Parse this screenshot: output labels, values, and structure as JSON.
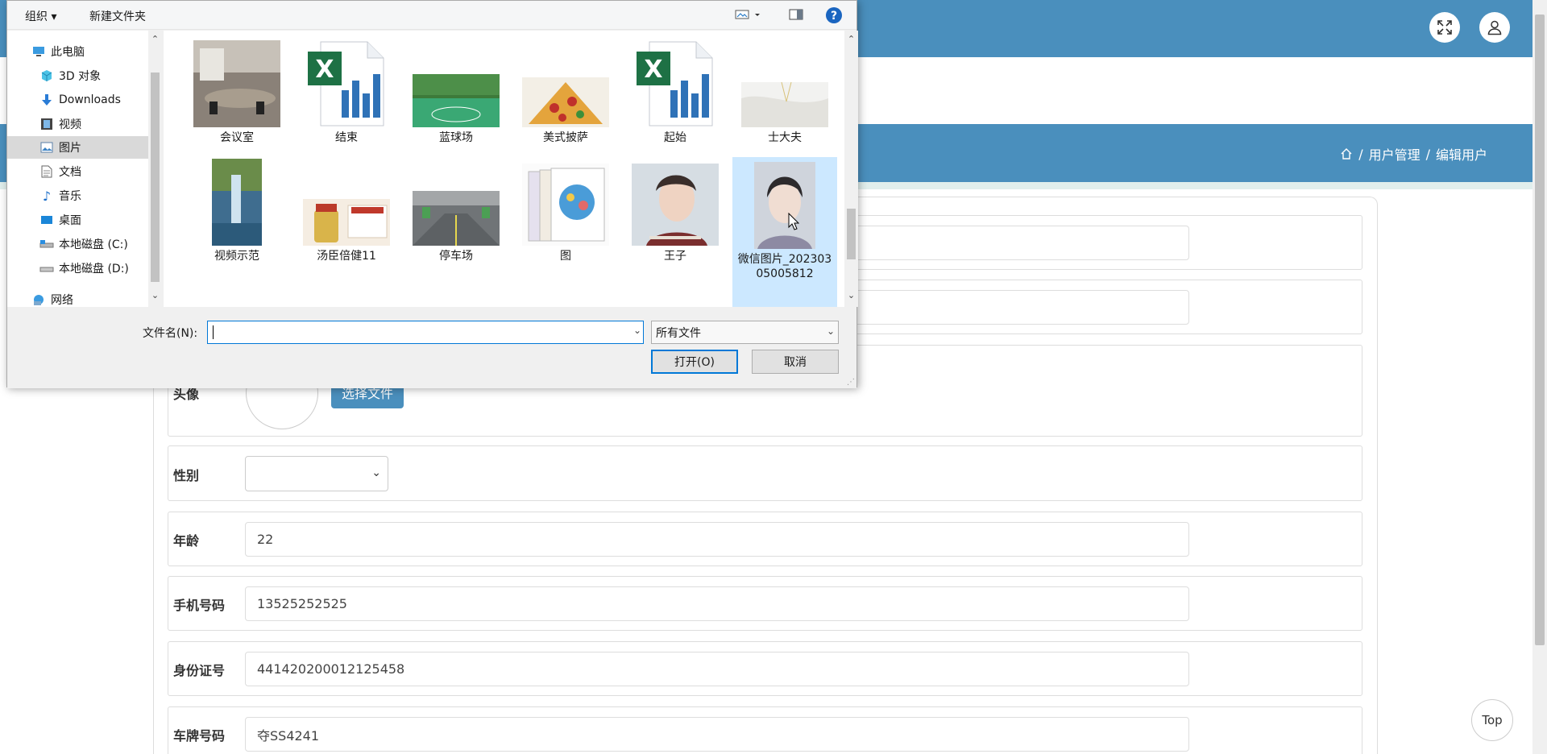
{
  "header": {
    "expand_icon": "expand-arrows-icon",
    "user_icon": "user-icon"
  },
  "breadcrumb": {
    "home_icon": "home-icon",
    "sep": "/",
    "item1": "用户管理",
    "item2": "编辑用户"
  },
  "form": {
    "avatar_label": "头像",
    "choose_file": "选择文件",
    "gender_label": "性别",
    "gender_value": "",
    "age_label": "年龄",
    "age_value": "22",
    "phone_label": "手机号码",
    "phone_value": "13525252525",
    "idcard_label": "身份证号",
    "idcard_value": "441420200012125458",
    "plate_label": "车牌号码",
    "plate_value": "夺SS4241"
  },
  "top_button": "Top",
  "dialog": {
    "toolbar": {
      "organize": "组织 ▾",
      "new_folder": "新建文件夹",
      "help": "?"
    },
    "nav": [
      {
        "label": "此电脑",
        "icon": "computer-icon"
      },
      {
        "label": "3D 对象",
        "icon": "cube-icon"
      },
      {
        "label": "Downloads",
        "icon": "download-arrow-icon"
      },
      {
        "label": "视频",
        "icon": "film-icon"
      },
      {
        "label": "图片",
        "icon": "picture-icon"
      },
      {
        "label": "文档",
        "icon": "document-icon"
      },
      {
        "label": "音乐",
        "icon": "music-note-icon"
      },
      {
        "label": "桌面",
        "icon": "desktop-icon"
      },
      {
        "label": "本地磁盘 (C:)",
        "icon": "drive-icon"
      },
      {
        "label": "本地磁盘 (D:)",
        "icon": "drive-icon"
      },
      {
        "label": "网络",
        "icon": "network-icon"
      }
    ],
    "files": [
      {
        "label": "会议室",
        "kind": "photo-meeting-room"
      },
      {
        "label": "结束",
        "kind": "excel-file"
      },
      {
        "label": "蓝球场",
        "kind": "photo-basketball-court"
      },
      {
        "label": "美式披萨",
        "kind": "photo-pizza"
      },
      {
        "label": "起始",
        "kind": "excel-file"
      },
      {
        "label": "士大夫",
        "kind": "photo-white-cloth"
      },
      {
        "label": "视频示范",
        "kind": "photo-waterfall"
      },
      {
        "label": "汤臣倍健11",
        "kind": "photo-supplement-box"
      },
      {
        "label": "停车场",
        "kind": "photo-parking-lot"
      },
      {
        "label": "图",
        "kind": "photo-books"
      },
      {
        "label": "王子",
        "kind": "photo-portrait"
      },
      {
        "label": "微信图片_20230305005812",
        "kind": "photo-portrait"
      }
    ],
    "filename_label": "文件名(N):",
    "filename_value": "",
    "filetype": "所有文件",
    "open_button": "打开(O)",
    "cancel_button": "取消"
  },
  "colors": {
    "brand": "#4a8fbd",
    "selection": "#cce8ff",
    "dialog_bg": "#f0f0f0"
  }
}
